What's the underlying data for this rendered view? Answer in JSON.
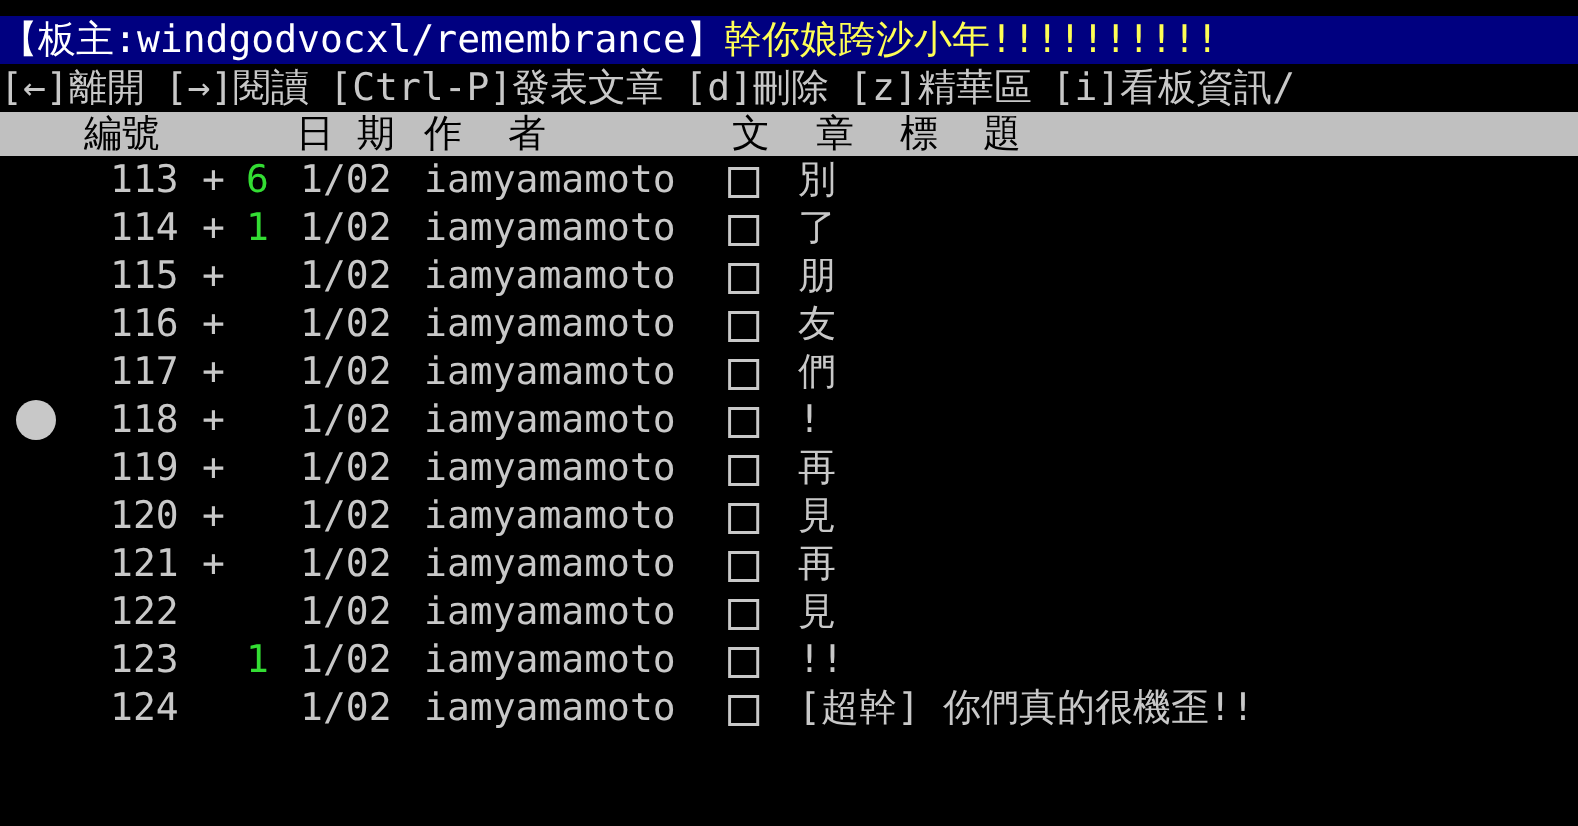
{
  "title_bar": {
    "moderator": "【板主:windgodvocxl/remembrance】",
    "board_name": "幹你娘跨沙小年!!!!!!!!!!"
  },
  "menu": [
    "[←]離開",
    "[→]閱讀",
    "[Ctrl-P]發表文章",
    "[d]刪除",
    "[z]精華區",
    "[i]看板資訊/"
  ],
  "header": [
    "編號",
    "日 期",
    "作  者",
    "文  章  標  題"
  ],
  "rows": [
    {
      "number": "113",
      "mark": "+",
      "recommend": "6",
      "date": "1/02",
      "author": "iamyamamoto",
      "box": "□",
      "title": "別",
      "selected": false
    },
    {
      "number": "114",
      "mark": "+",
      "recommend": "1",
      "date": "1/02",
      "author": "iamyamamoto",
      "box": "□",
      "title": "了",
      "selected": false
    },
    {
      "number": "115",
      "mark": "+",
      "date": "1/02",
      "author": "iamyamamoto",
      "box": "□",
      "title": "朋",
      "selected": false
    },
    {
      "number": "116",
      "mark": "+",
      "date": "1/02",
      "author": "iamyamamoto",
      "box": "□",
      "title": "友",
      "selected": false
    },
    {
      "number": "117",
      "mark": "+",
      "date": "1/02",
      "author": "iamyamamoto",
      "box": "□",
      "title": "們",
      "selected": false
    },
    {
      "number": "118",
      "mark": "+",
      "date": "1/02",
      "author": "iamyamamoto",
      "box": "□",
      "title": "!",
      "selected": true
    },
    {
      "number": "119",
      "mark": "+",
      "date": "1/02",
      "author": "iamyamamoto",
      "box": "□",
      "title": "再",
      "selected": false
    },
    {
      "number": "120",
      "mark": "+",
      "date": "1/02",
      "author": "iamyamamoto",
      "box": "□",
      "title": "見",
      "selected": false
    },
    {
      "number": "121",
      "mark": "+",
      "date": "1/02",
      "author": "iamyamamoto",
      "box": "□",
      "title": "再",
      "selected": false
    },
    {
      "number": "122",
      "date": "1/02",
      "author": "iamyamamoto",
      "box": "□",
      "title": "見",
      "selected": false
    },
    {
      "number": "123",
      "recommend": "1",
      "date": "1/02",
      "author": "iamyamamoto",
      "box": "□",
      "title": "!!",
      "selected": false
    },
    {
      "number": "124",
      "date": "1/02",
      "author": "iamyamamoto",
      "box": "□",
      "title": "[超幹] 你們真的很機歪!!",
      "selected": false
    }
  ]
}
